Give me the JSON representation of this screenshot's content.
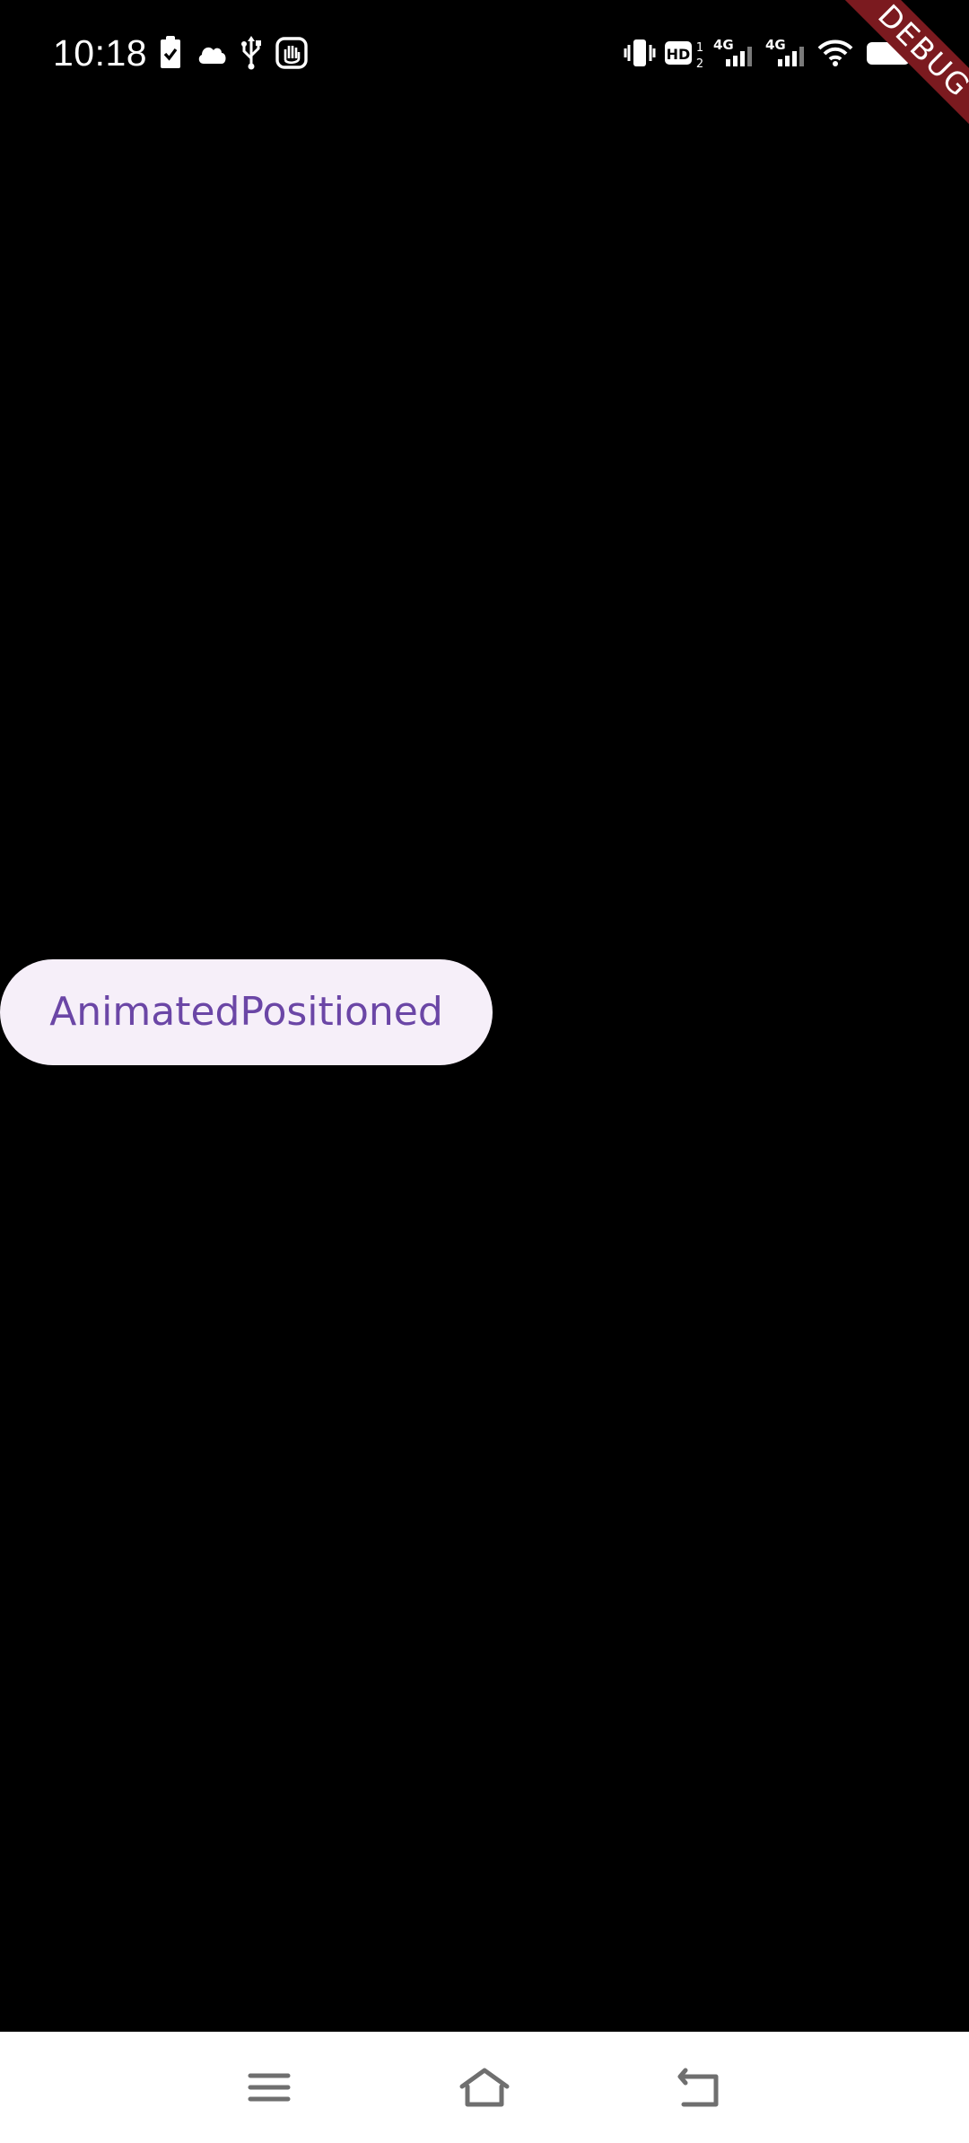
{
  "status_bar": {
    "time": "10:18",
    "left_icons": [
      "clipboard-check-icon",
      "cloud-icon",
      "usb-icon",
      "accessibility-hand-icon"
    ],
    "right_icons": [
      "vibrate-icon",
      "hd-voice-icon",
      "signal-4g-1-icon",
      "signal-4g-2-icon",
      "wifi-icon",
      "battery-icon"
    ],
    "hd_label": "HD",
    "hd_sub_top": "1",
    "hd_sub_bottom": "2",
    "network_label_1": "4G",
    "network_label_2": "4G"
  },
  "debug_banner": {
    "label": "DEBUG",
    "color": "#7b1a1f"
  },
  "main": {
    "button_label": "AnimatedPositioned",
    "button_bg": "#f6eff9",
    "button_text_color": "#6b46a6"
  },
  "nav_bar": {
    "items": [
      "menu-icon",
      "home-icon",
      "back-icon"
    ]
  }
}
